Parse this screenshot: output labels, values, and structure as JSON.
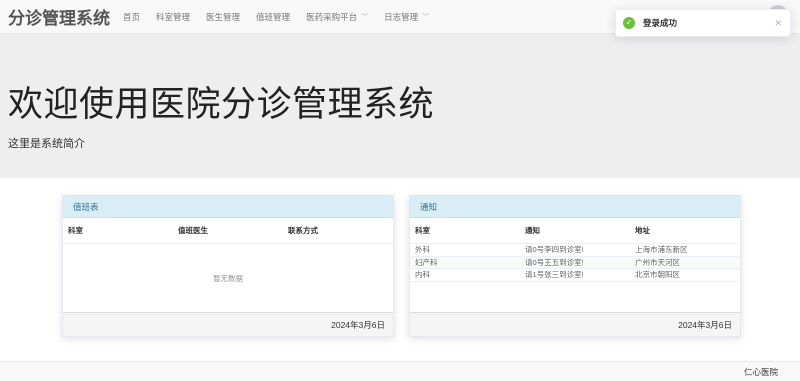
{
  "nav": {
    "brand": "分诊管理系统",
    "items": [
      {
        "label": "首页",
        "dropdown": false
      },
      {
        "label": "科室管理",
        "dropdown": false
      },
      {
        "label": "医生管理",
        "dropdown": false
      },
      {
        "label": "值班管理",
        "dropdown": false
      },
      {
        "label": "医药采购平台",
        "dropdown": true
      },
      {
        "label": "日志管理",
        "dropdown": true
      }
    ]
  },
  "jumbotron": {
    "title": "欢迎使用医院分诊管理系统",
    "subtitle": "这里是系统简介"
  },
  "duty_panel": {
    "title": "值班表",
    "columns": [
      "科室",
      "值班医生",
      "联系方式"
    ],
    "empty_text": "暂无数据",
    "date": "2024年3月6日"
  },
  "notice_panel": {
    "title": "通知",
    "columns": [
      "科室",
      "通知",
      "地址"
    ],
    "rows": [
      [
        "外科",
        "请0号李四到诊室!",
        "上海市浦东新区"
      ],
      [
        "妇产科",
        "请0号王五到诊室!",
        "广州市天河区"
      ],
      [
        "内科",
        "请1号张三到诊室!",
        "北京市朝阳区"
      ]
    ],
    "date": "2024年3月6日"
  },
  "footer": {
    "text": "仁心医院"
  },
  "toast": {
    "message": "登录成功",
    "icon": "check-circle-icon",
    "color": "#67c23a"
  }
}
